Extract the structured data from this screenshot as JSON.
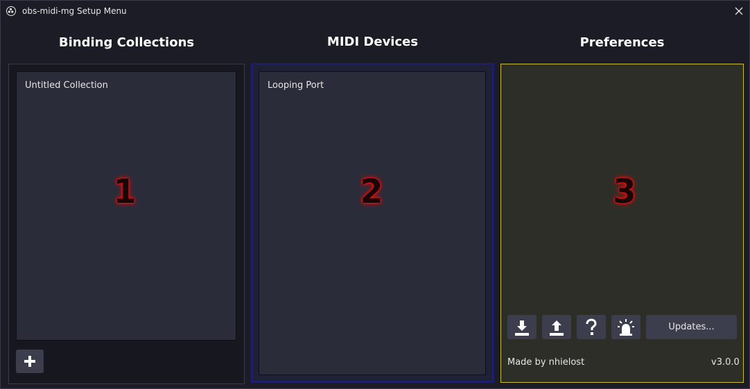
{
  "window": {
    "title": "obs-midi-mg Setup Menu"
  },
  "columns": {
    "bindings": {
      "heading": "Binding Collections",
      "items": [
        "Untitled Collection"
      ],
      "marker": "1"
    },
    "devices": {
      "heading": "MIDI Devices",
      "items": [
        "Looping Port"
      ],
      "marker": "2"
    },
    "preferences": {
      "heading": "Preferences",
      "marker": "3"
    }
  },
  "preferences": {
    "updates_label": "Updates...",
    "credit": "Made by nhielost",
    "version": "v3.0.0",
    "icons": [
      "import-icon",
      "export-icon",
      "help-icon",
      "alarm-icon"
    ]
  },
  "colors": {
    "background": "#1b1c25",
    "devices_border": "#1d1f6c",
    "preferences_border": "#c9bf2e",
    "marker_glow": "#ff1010"
  }
}
